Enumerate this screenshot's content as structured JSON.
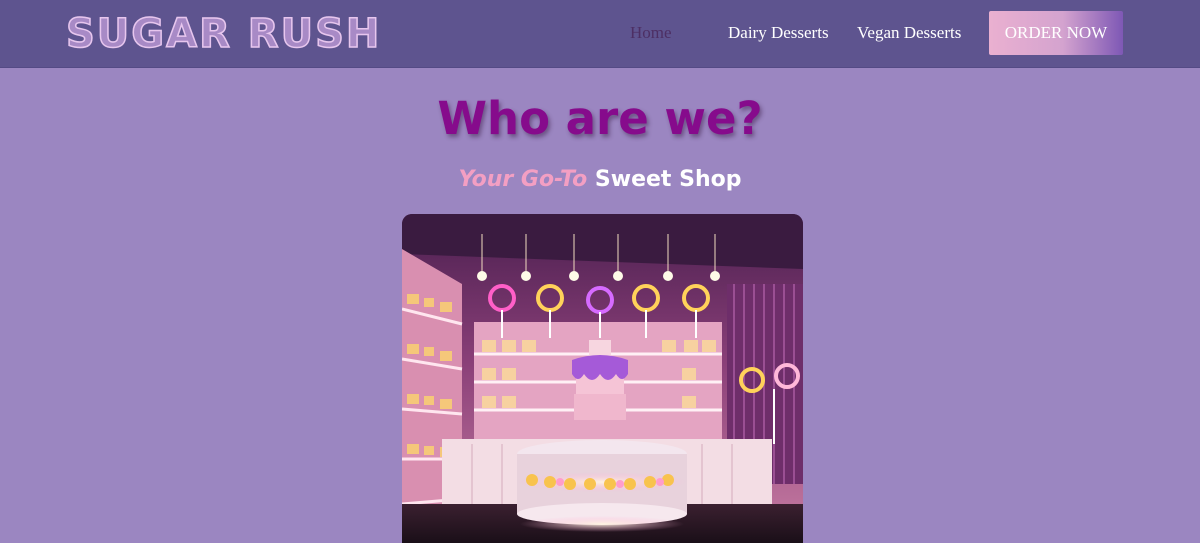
{
  "header": {
    "logo_text": "SUGAR RUSH",
    "nav": {
      "home": "Home",
      "dairy": "Dairy Desserts",
      "vegan": "Vegan Desserts"
    },
    "order_button": "ORDER NOW"
  },
  "main": {
    "heading": "Who are we?",
    "subheading_accent": "Your Go-To",
    "subheading_rest": "Sweet Shop"
  },
  "colors": {
    "background": "#9b86c1",
    "navbar": "#5e548f",
    "heading": "#860b8c",
    "accent_pink": "#f39fc3"
  }
}
